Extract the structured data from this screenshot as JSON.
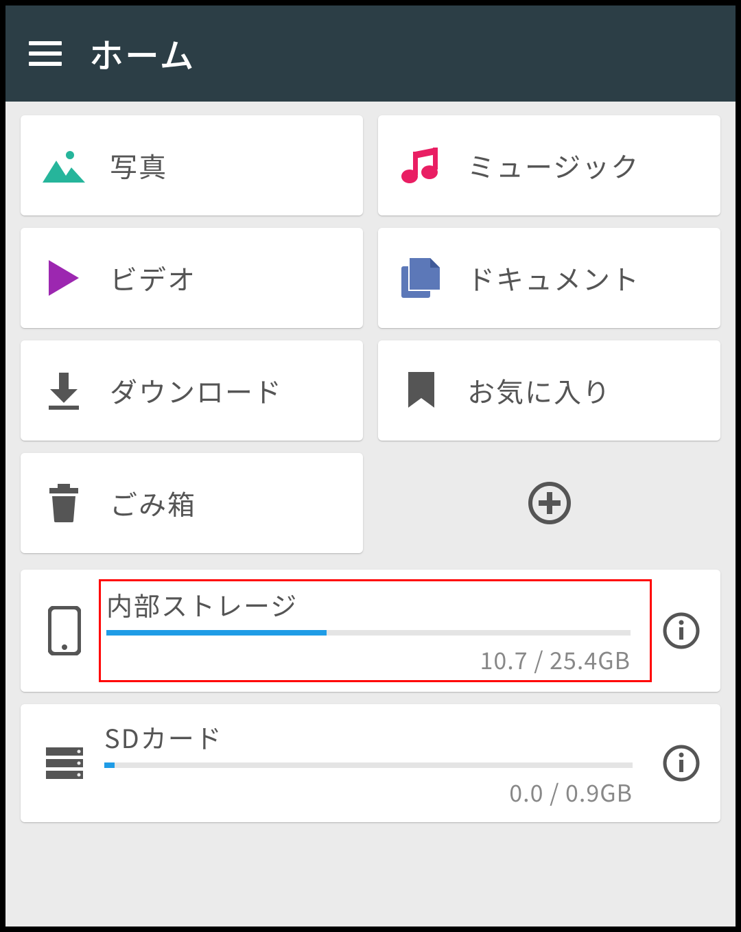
{
  "header": {
    "title": "ホーム"
  },
  "categories": {
    "photos": {
      "label": "写真"
    },
    "music": {
      "label": "ミュージック"
    },
    "video": {
      "label": "ビデオ"
    },
    "documents": {
      "label": "ドキュメント"
    },
    "downloads": {
      "label": "ダウンロード"
    },
    "favorites": {
      "label": "お気に入り"
    },
    "trash": {
      "label": "ごみ箱"
    }
  },
  "storage": {
    "internal": {
      "title": "内部ストレージ",
      "used": 10.7,
      "total": 25.4,
      "unit": "GB",
      "usage_text": "10.7 / 25.4GB",
      "percent": 42,
      "highlighted": true
    },
    "sdcard": {
      "title": "SDカード",
      "used": 0.0,
      "total": 0.9,
      "unit": "GB",
      "usage_text": "0.0 / 0.9GB",
      "percent": 2,
      "highlighted": false
    }
  },
  "icons": {
    "hamburger": "hamburger-icon",
    "add": "add-icon",
    "info": "info-icon"
  }
}
